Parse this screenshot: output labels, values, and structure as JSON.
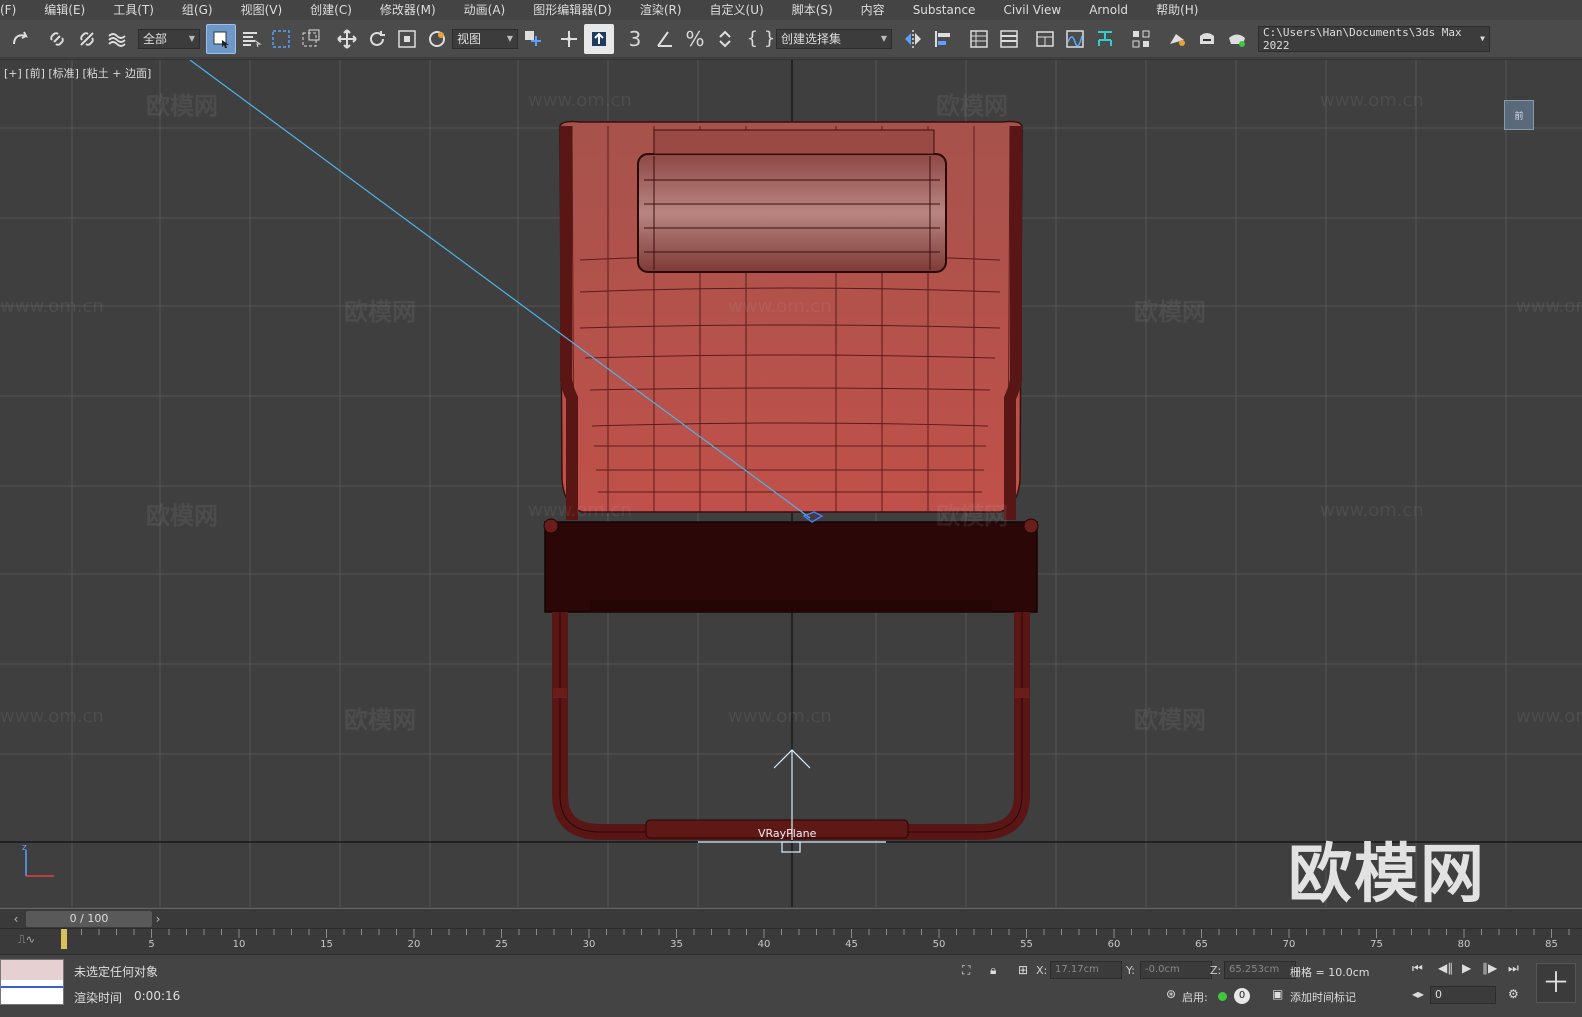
{
  "menu": [
    "(F)",
    "编辑(E)",
    "工具(T)",
    "组(G)",
    "视图(V)",
    "创建(C)",
    "修改器(M)",
    "动画(A)",
    "图形编辑器(D)",
    "渲染(R)",
    "自定义(U)",
    "脚本(S)",
    "内容",
    "Substance",
    "Civil View",
    "Arnold",
    "帮助(H)"
  ],
  "toolbar": {
    "selection_filter": "全部",
    "reference_coord": "视图",
    "named_selection": "创建选择集",
    "project_path": "C:\\Users\\Han\\Documents\\3ds Max 2022",
    "snap_label": "3"
  },
  "viewport": {
    "label": "[+] [前] [标准] [粘土 + 边面]",
    "object_label": "VRayPlane",
    "viewcube_label": "前",
    "watermark_cn": "欧模网",
    "watermark_url": "www.om.cn",
    "watermark_big": "欧模网",
    "background_color": "#3f3f3f",
    "model_color": "#a8433c"
  },
  "timeline": {
    "frame_display": "0 / 100",
    "ticks": [
      "5",
      "10",
      "15",
      "20",
      "25",
      "30",
      "35",
      "40",
      "45",
      "50",
      "55",
      "60",
      "65",
      "70",
      "75",
      "80",
      "85"
    ]
  },
  "status": {
    "selection_text": "未选定任何对象",
    "render_time_label": "渲染时间",
    "render_time_value": "0:00:16",
    "x_label": "X:",
    "x_value": "17.17cm",
    "y_label": "Y:",
    "y_value": "-0.0cm",
    "z_label": "Z:",
    "z_value": "65.253cm",
    "grid_text": "栅格 = 10.0cm",
    "enable_label": "启用:",
    "enable_count": "0",
    "add_key_label": "添加时间标记",
    "frame_value": "0"
  }
}
